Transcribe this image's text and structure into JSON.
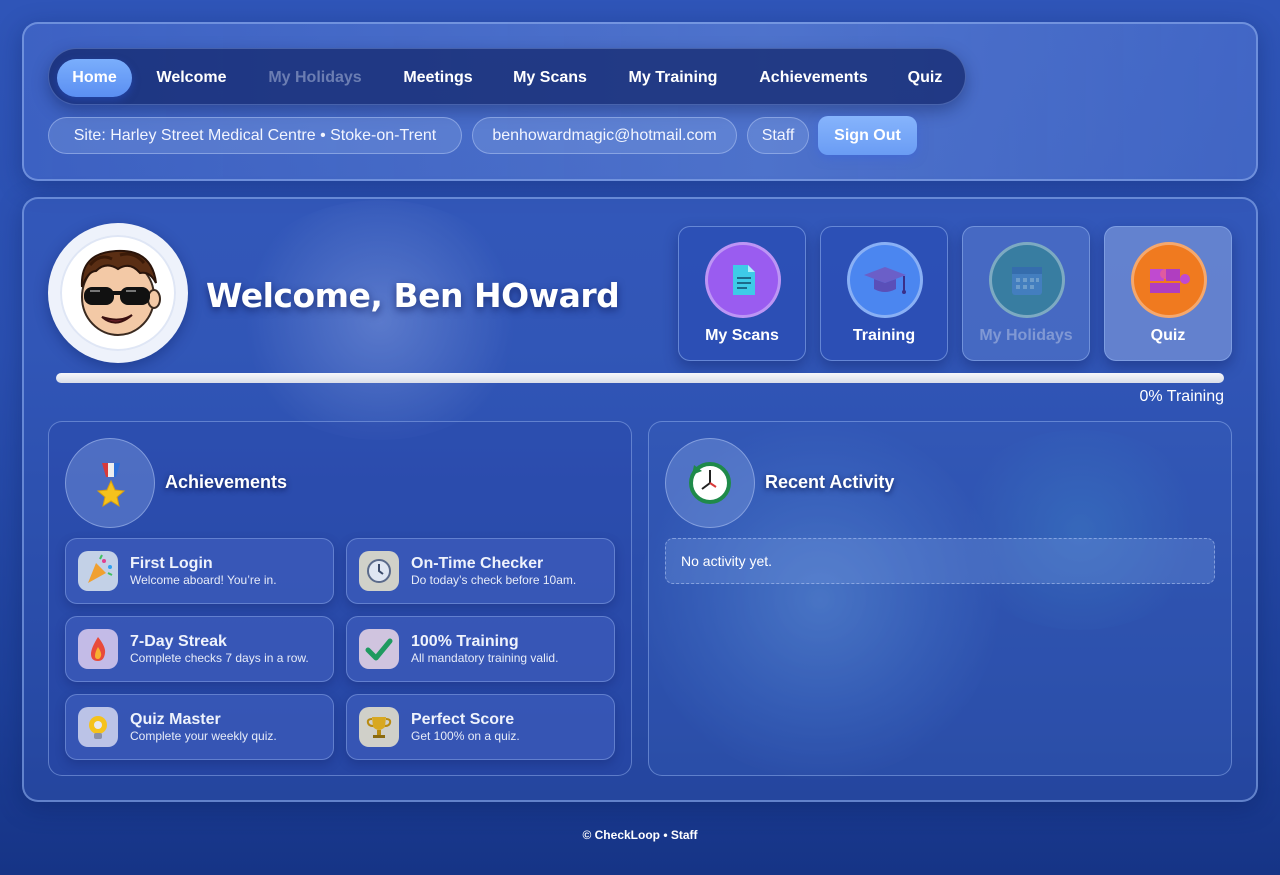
{
  "nav": {
    "items": [
      {
        "label": "Home",
        "state": "active"
      },
      {
        "label": "Welcome",
        "state": "normal"
      },
      {
        "label": "My Holidays",
        "state": "disabled"
      },
      {
        "label": "Meetings",
        "state": "normal"
      },
      {
        "label": "My Scans",
        "state": "normal"
      },
      {
        "label": "My Training",
        "state": "normal"
      },
      {
        "label": "Achievements",
        "state": "normal"
      },
      {
        "label": "Quiz",
        "state": "normal"
      }
    ]
  },
  "user_bar": {
    "site": "Site: Harley Street Medical Centre • Stoke-on-Trent",
    "email": "benhowardmagic@hotmail.com",
    "role": "Staff",
    "sign_out": "Sign Out"
  },
  "hero": {
    "welcome": "Welcome, Ben HOward",
    "avatar_icon": "cartoon-avatar-sunglasses"
  },
  "quick_links": [
    {
      "label": "My Scans",
      "icon": "document-icon",
      "color": "#9a5cf0",
      "state": "normal"
    },
    {
      "label": "Training",
      "icon": "graduation-cap-icon",
      "color": "#4b86f0",
      "state": "normal"
    },
    {
      "label": "My Holidays",
      "icon": "calendar-icon",
      "color": "#2f8a8a",
      "state": "disabled"
    },
    {
      "label": "Quiz",
      "icon": "puzzle-icon",
      "color": "#f07a1f",
      "state": "normal"
    }
  ],
  "training_progress": {
    "percent": 0,
    "label": "0% Training"
  },
  "achievements": {
    "title": "Achievements",
    "icon": "medal-icon",
    "items": [
      {
        "title": "First Login",
        "subtitle": "Welcome aboard! You’re in.",
        "icon": "party-popper-icon"
      },
      {
        "title": "On-Time Checker",
        "subtitle": "Do today’s check before 10am.",
        "icon": "clock-icon"
      },
      {
        "title": "7-Day Streak",
        "subtitle": "Complete checks 7 days in a row.",
        "icon": "flame-icon"
      },
      {
        "title": "100% Training",
        "subtitle": "All mandatory training valid.",
        "icon": "checkmark-icon"
      },
      {
        "title": "Quiz Master",
        "subtitle": "Complete your weekly quiz.",
        "icon": "lightbulb-icon"
      },
      {
        "title": "Perfect Score",
        "subtitle": "Get 100% on a quiz.",
        "icon": "trophy-icon"
      }
    ]
  },
  "activity": {
    "title": "Recent Activity",
    "icon": "history-clock-icon",
    "empty_text": "No activity yet."
  },
  "footer": {
    "text": "© CheckLoop • Staff"
  },
  "colors": {
    "accent": "#6a9cf4",
    "background": "#2a4fb0"
  }
}
